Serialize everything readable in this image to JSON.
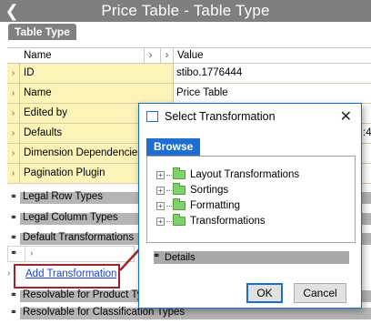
{
  "titlebar": {
    "title": "Price Table - Table Type"
  },
  "tab": {
    "label": "Table Type"
  },
  "grid": {
    "columns": {
      "name": "Name",
      "value": "Value"
    },
    "rows": [
      {
        "name": "ID",
        "value": "stibo.1776444"
      },
      {
        "name": "Name",
        "value": "Price Table"
      },
      {
        "name": "Edited by",
        "value": ""
      },
      {
        "name": "Defaults",
        "value": ":4"
      },
      {
        "name": "Dimension Dependencies",
        "value": ""
      },
      {
        "name": "Pagination Plugin",
        "value": ""
      }
    ]
  },
  "sections": {
    "legal_row_types": "Legal Row Types",
    "legal_column_types": "Legal Column Types",
    "default_transformations": "Default Transformations",
    "resolvable_product": "Resolvable for Product Ty",
    "resolvable_classification": "Resolvable for Classification Types"
  },
  "add_transformation": "Add Transformation",
  "dialog": {
    "title": "Select Transformation",
    "tab": "Browse",
    "tree": [
      "Layout Transformations",
      "Sortings",
      "Formatting",
      "Transformations"
    ],
    "details": "Details",
    "ok": "OK",
    "cancel": "Cancel"
  },
  "colors": {
    "highlight": "#a0222a",
    "accent": "#1f6fd0",
    "folder": "#7fd26b",
    "row_bg": "#fbf3b8"
  }
}
